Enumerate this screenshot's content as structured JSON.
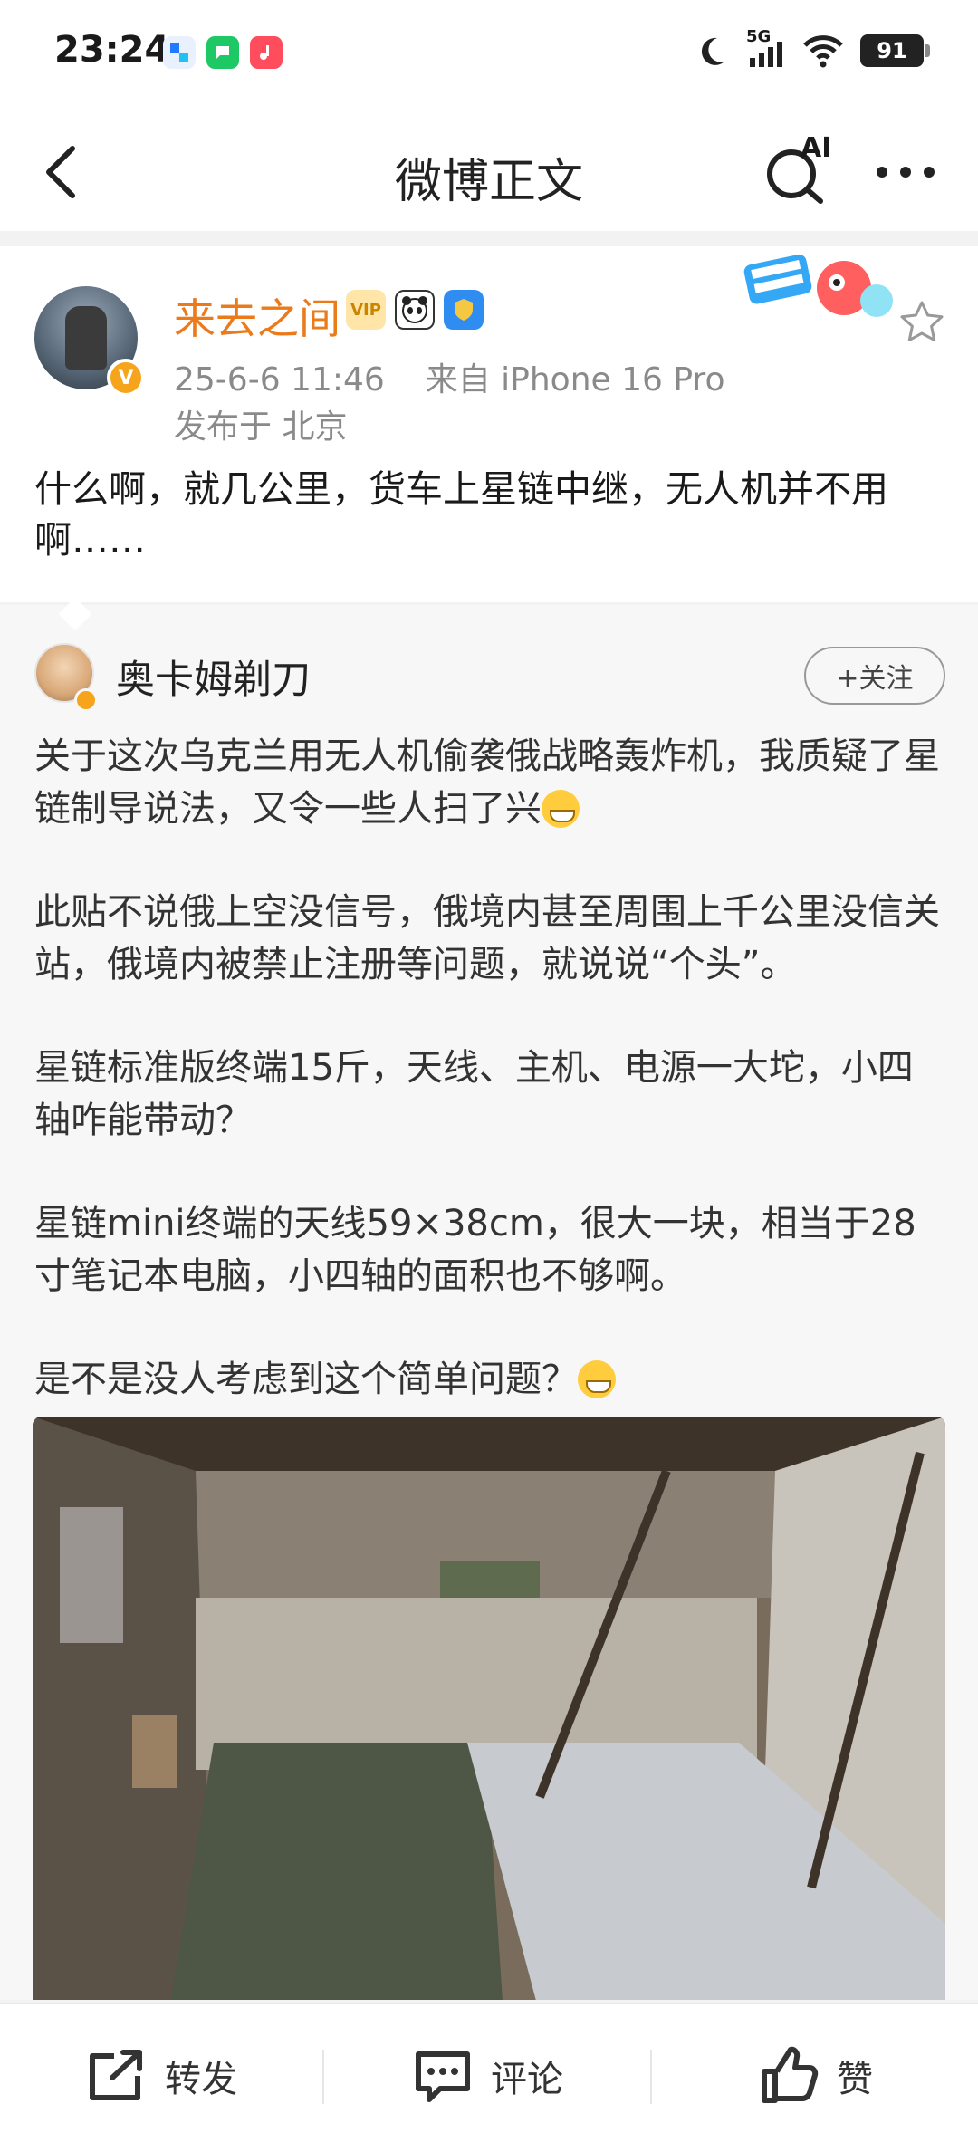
{
  "status_bar": {
    "time": "23:24",
    "network": "5G",
    "battery": "91"
  },
  "nav": {
    "title": "微博正文",
    "ai_label": "AI"
  },
  "post": {
    "username": "来去之间",
    "vip_badge": "VIP",
    "timestamp": "25-6-6 11:46",
    "source": "来自 iPhone 16 Pro",
    "location": "发布于 北京",
    "text": "什么啊，就几公里，货车上星链中继，无人机并不用啊……"
  },
  "quoted_post": {
    "username": "奥卡姆剃刀",
    "follow_label": "+关注",
    "paragraphs": [
      "关于这次乌克兰用无人机偷袭俄战略轰炸机，我质疑了星链制导说法，又令一些人扫了兴",
      "此贴不说俄上空没信号，俄境内甚至周围上千公里没信关站，俄境内被禁止注册等问题，就说说“个头”。",
      "星链标准版终端15斤，天线、主机、电源一大坨，小四轴咋能带动？",
      "星链mini终端的天线59×38cm，很大一块，相当于28寸笔记本电脑，小四轴的面积也不够啊。",
      "是不是没人考虑到这个简单问题？"
    ]
  },
  "actions": {
    "repost": "转发",
    "comment": "评论",
    "like": "赞"
  },
  "colors": {
    "username_orange": "#eb7a1a",
    "meta_gray": "#8a8a8a",
    "badge_gold": "#f7a41d"
  }
}
